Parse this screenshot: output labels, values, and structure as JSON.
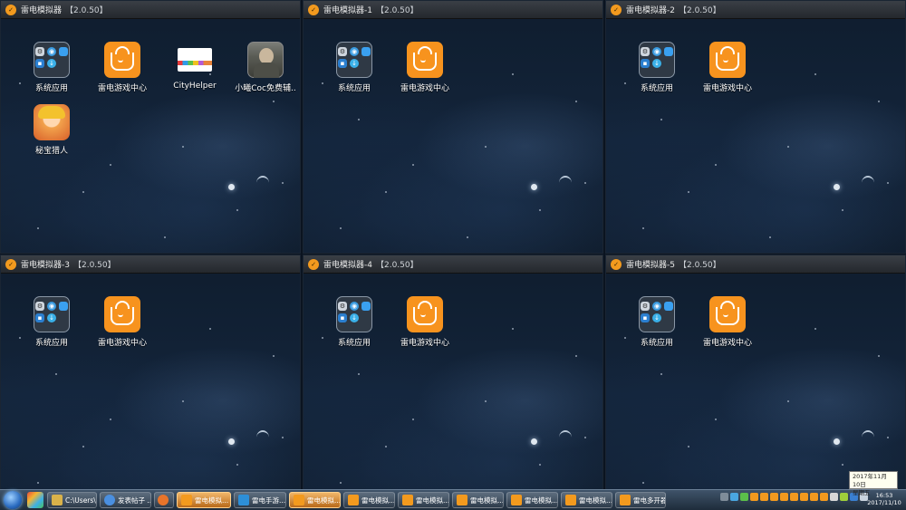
{
  "panels": [
    {
      "title": "雷电模拟器",
      "version": "【2.0.50】",
      "icons": [
        {
          "label": "系统应用",
          "type": "system"
        },
        {
          "label": "雷电游戏中心",
          "type": "game-center"
        },
        {
          "label": "CityHelper",
          "type": "cityhelper"
        },
        {
          "label": "小曦Coc免费辅..",
          "type": "portrait"
        },
        {
          "label": "秘宝猎人",
          "type": "anime"
        }
      ]
    },
    {
      "title": "雷电模拟器-1",
      "version": "【2.0.50】",
      "icons": [
        {
          "label": "系统应用",
          "type": "system"
        },
        {
          "label": "雷电游戏中心",
          "type": "game-center"
        }
      ]
    },
    {
      "title": "雷电模拟器-2",
      "version": "【2.0.50】",
      "icons": [
        {
          "label": "系统应用",
          "type": "system"
        },
        {
          "label": "雷电游戏中心",
          "type": "game-center"
        }
      ]
    },
    {
      "title": "雷电模拟器-3",
      "version": "【2.0.50】",
      "icons": [
        {
          "label": "系统应用",
          "type": "system"
        },
        {
          "label": "雷电游戏中心",
          "type": "game-center"
        }
      ]
    },
    {
      "title": "雷电模拟器-4",
      "version": "【2.0.50】",
      "icons": [
        {
          "label": "系统应用",
          "type": "system"
        },
        {
          "label": "雷电游戏中心",
          "type": "game-center"
        }
      ]
    },
    {
      "title": "雷电模拟器-5",
      "version": "【2.0.50】",
      "icons": [
        {
          "label": "系统应用",
          "type": "system"
        },
        {
          "label": "雷电游戏中心",
          "type": "game-center"
        }
      ]
    }
  ],
  "taskbar": {
    "items": [
      {
        "label": "C:\\Users\\...",
        "icon": "folder-icon",
        "color": "#d9b24a",
        "active": false
      },
      {
        "label": "发表帖子 ...",
        "icon": "chrome-icon",
        "color": "#4a8fe0",
        "active": false
      },
      {
        "label": "",
        "icon": "firefox-icon",
        "color": "#e8742a",
        "active": false
      },
      {
        "label": "雷电模拟...",
        "icon": "ldplayer-icon",
        "color": "#f39a1e",
        "active": true
      },
      {
        "label": "雷电手游...",
        "icon": "ldplayer-store-icon",
        "color": "#2d8fd8",
        "active": false
      },
      {
        "label": "雷电模拟...",
        "icon": "ldplayer-icon",
        "color": "#f39a1e",
        "active": true
      },
      {
        "label": "雷电模拟...",
        "icon": "ldplayer-icon",
        "color": "#f39a1e",
        "active": false
      },
      {
        "label": "雷电模拟...",
        "icon": "ldplayer-icon",
        "color": "#f39a1e",
        "active": false
      },
      {
        "label": "雷电模拟...",
        "icon": "ldplayer-icon",
        "color": "#f39a1e",
        "active": false
      },
      {
        "label": "雷电模拟...",
        "icon": "ldplayer-icon",
        "color": "#f39a1e",
        "active": false
      },
      {
        "label": "雷电模拟...",
        "icon": "ldplayer-icon",
        "color": "#f39a1e",
        "active": false
      },
      {
        "label": "雷电多开器",
        "icon": "multi-instance-icon",
        "color": "#f39a1e",
        "active": false
      }
    ],
    "clock_time": "16:53",
    "clock_date": "2017/11/10",
    "tooltip_date": "2017年11月10日",
    "tooltip_weekday": "星期五"
  }
}
